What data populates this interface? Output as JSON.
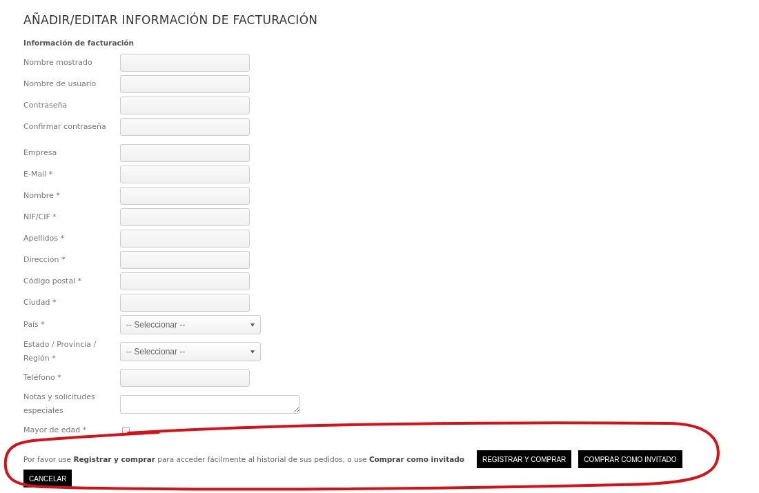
{
  "title": "AÑADIR/EDITAR INFORMACIÓN DE FACTURACIÓN",
  "section_title": "Información de facturación",
  "field_groups": [
    [
      {
        "kind": "text",
        "label": "Nombre mostrado"
      },
      {
        "kind": "text",
        "label": "Nombre de usuario"
      },
      {
        "kind": "text",
        "label": "Contraseña"
      },
      {
        "kind": "text",
        "label": "Confirmar contraseña"
      }
    ],
    [
      {
        "kind": "text",
        "label": "Empresa"
      },
      {
        "kind": "text",
        "label": "E-Mail *"
      },
      {
        "kind": "text",
        "label": "Nombre *"
      },
      {
        "kind": "text",
        "label": "NIF/CIF *"
      },
      {
        "kind": "text",
        "label": "Apellidos *"
      },
      {
        "kind": "text",
        "label": "Dirección *"
      },
      {
        "kind": "text",
        "label": "Código postal *"
      },
      {
        "kind": "text",
        "label": "Ciudad *"
      },
      {
        "kind": "select",
        "label": "País *",
        "value": "-- Seleccionar --"
      },
      {
        "kind": "select",
        "label": "Estado / Provincia / Región *",
        "value": "-- Seleccionar --"
      },
      {
        "kind": "text",
        "label": "Teléfono *"
      },
      {
        "kind": "textarea",
        "label": "Notas y solicitudes especiales"
      },
      {
        "kind": "checkbox",
        "label": "Mayor de edad *",
        "checked": false
      }
    ]
  ],
  "notice": "Por favor use **Registrar y comprar** para acceder fácilmente al historial de sus pedidos, o use **Comprar como invitado**",
  "buttons": [
    "REGISTRAR Y COMPRAR",
    "COMPRAR COMO INVITADO"
  ],
  "cancel_button": "CANCELAR",
  "annotation": {
    "kind": "loop",
    "color": "#d4121a"
  }
}
